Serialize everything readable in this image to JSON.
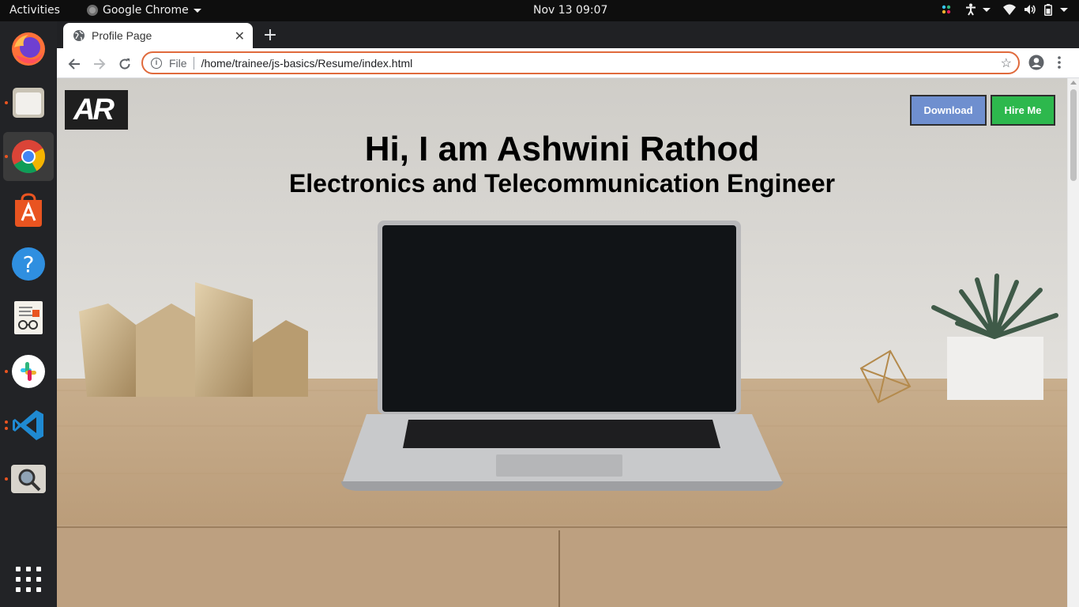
{
  "topbar": {
    "activities": "Activities",
    "app_name": "Google Chrome",
    "clock": "Nov 13  09:07"
  },
  "dock": {
    "items": [
      "firefox-icon",
      "files-icon",
      "chrome-icon",
      "software-center-icon",
      "help-icon",
      "document-viewer-icon",
      "slack-icon",
      "vscode-icon",
      "image-viewer-icon"
    ],
    "show_apps": "show-applications-icon"
  },
  "browser": {
    "tab_title": "Profile Page",
    "omnibox_scheme": "File",
    "url": "/home/trainee/js-basics/Resume/index.html",
    "accent_color": "#e06a3c"
  },
  "page": {
    "logo_text": "AR",
    "download_label": "Download",
    "hire_label": "Hire Me",
    "headline": "Hi, I am Ashwini Rathod",
    "subheadline": "Electronics and Telecommunication Engineer",
    "colors": {
      "download_bg": "#6f8fcf",
      "hire_bg": "#2db84d"
    }
  }
}
